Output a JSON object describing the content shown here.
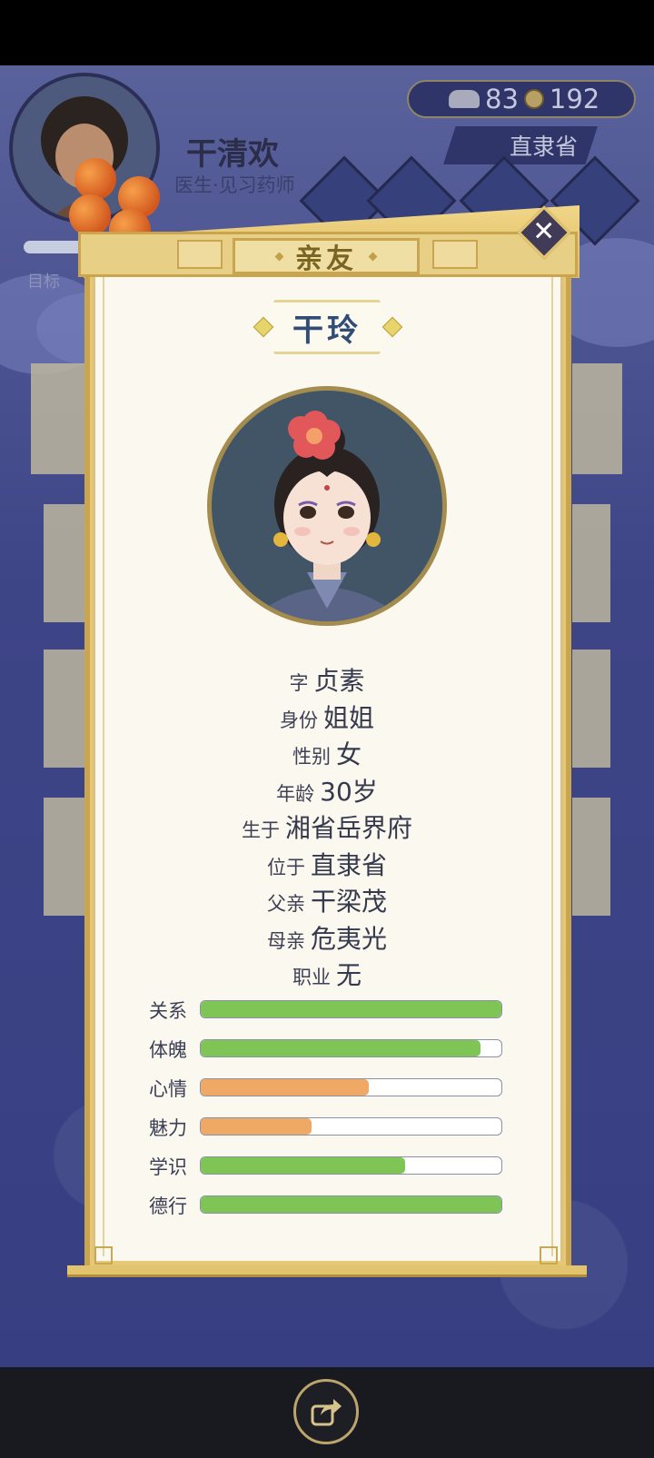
{
  "hud": {
    "player_name": "干清欢",
    "player_title": "医生·见习药师",
    "silver": "83",
    "coins": "192",
    "location": "直隶省",
    "goal_label": "目标"
  },
  "modal": {
    "title": "亲友",
    "close_symbol": "✕",
    "person_name": "干玲",
    "info": [
      {
        "label": "字",
        "value": "贞素"
      },
      {
        "label": "身份",
        "value": "姐姐"
      },
      {
        "label": "性别",
        "value": "女"
      },
      {
        "label": "年龄",
        "value": "30岁"
      },
      {
        "label": "生于",
        "value": "湘省岳界府"
      },
      {
        "label": "位于",
        "value": "直隶省"
      },
      {
        "label": "父亲",
        "value": "干梁茂"
      },
      {
        "label": "母亲",
        "value": "危夷光"
      },
      {
        "label": "职业",
        "value": "无"
      }
    ],
    "stats": [
      {
        "label": "关系",
        "percent": 100,
        "color": "#7ec556"
      },
      {
        "label": "体魄",
        "percent": 93,
        "color": "#7ec556"
      },
      {
        "label": "心情",
        "percent": 56,
        "color": "#efa964"
      },
      {
        "label": "魅力",
        "percent": 37,
        "color": "#efa964"
      },
      {
        "label": "学识",
        "percent": 68,
        "color": "#7ec556"
      },
      {
        "label": "德行",
        "percent": 100,
        "color": "#7ec556"
      }
    ]
  },
  "icons": {
    "close": "close-icon",
    "share": "share-icon",
    "silver": "silver-ingot-icon",
    "coin": "copper-coin-icon"
  }
}
